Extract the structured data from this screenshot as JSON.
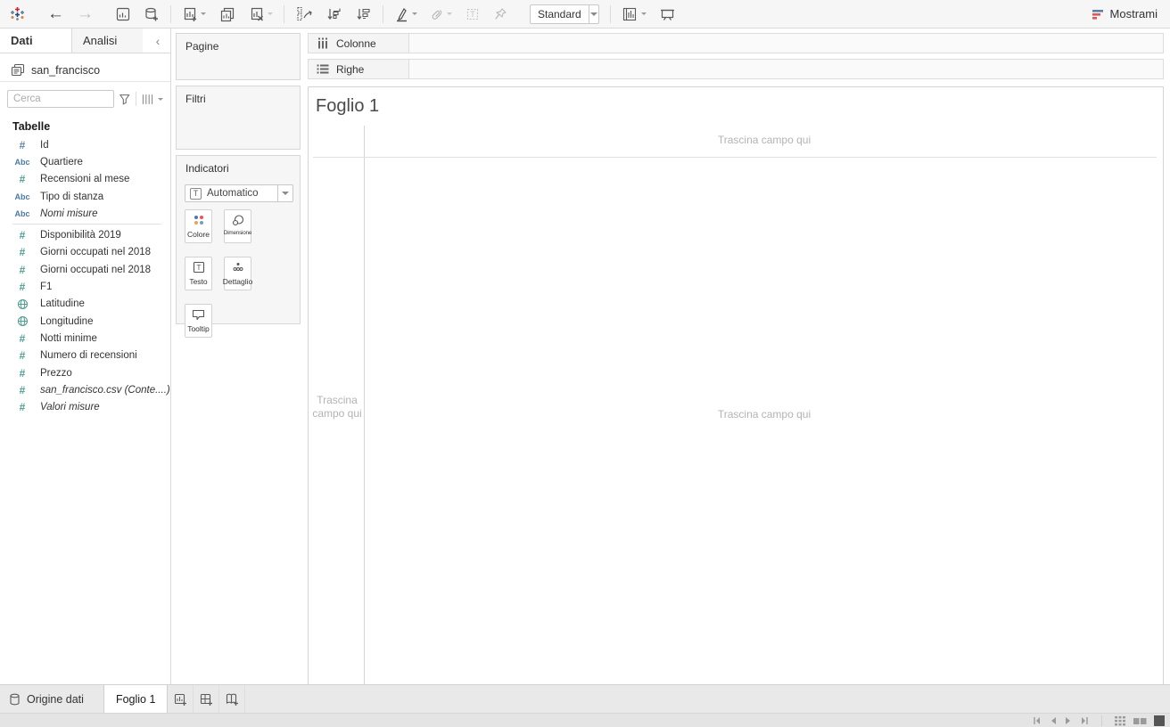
{
  "toolbar": {
    "standard_select_value": "Standard",
    "showme_label": "Mostrami"
  },
  "left_panel": {
    "tabs": {
      "data": "Dati",
      "analytics": "Analisi"
    },
    "datasource_name": "san_francisco",
    "search_placeholder": "Cerca",
    "tables_header": "Tabelle",
    "fields": [
      {
        "name": "Id",
        "type": "number-dimension"
      },
      {
        "name": "Quartiere",
        "type": "string"
      },
      {
        "name": "Recensioni al mese",
        "type": "number"
      },
      {
        "name": "Tipo di stanza",
        "type": "string"
      },
      {
        "name": "Nomi misure",
        "type": "string",
        "italic": true
      },
      {
        "name": "Disponibilità 2019",
        "type": "number"
      },
      {
        "name": "Giorni occupati nel 2018",
        "type": "number"
      },
      {
        "name": "Giorni occupati nel 2018",
        "type": "number"
      },
      {
        "name": "F1",
        "type": "number"
      },
      {
        "name": "Latitudine",
        "type": "geo"
      },
      {
        "name": "Longitudine",
        "type": "geo"
      },
      {
        "name": "Notti minime",
        "type": "number"
      },
      {
        "name": "Numero di recensioni",
        "type": "number"
      },
      {
        "name": "Prezzo",
        "type": "number"
      },
      {
        "name": "san_francisco.csv (Conte....)",
        "type": "number",
        "italic": true
      },
      {
        "name": "Valori misure",
        "type": "number",
        "italic": true
      }
    ]
  },
  "cards": {
    "pages_title": "Pagine",
    "filters_title": "Filtri",
    "marks_title": "Indicatori",
    "mark_type_value": "Automatico",
    "mark_buttons": {
      "color": "Colore",
      "size": "Dimensione",
      "text": "Testo",
      "detail": "Dettaglio",
      "tooltip": "Tooltip"
    }
  },
  "shelves": {
    "columns_label": "Colonne",
    "rows_label": "Righe"
  },
  "sheet": {
    "title": "Foglio 1",
    "drop_hint": "Trascina campo qui"
  },
  "bottom": {
    "datasource_tab": "Origine dati",
    "sheet_tab": "Foglio 1"
  },
  "colors": {
    "measure_green": "#4f9e91",
    "dimension_blue": "#4a79a7",
    "showme_blue": "#5b7fa6",
    "showme_red": "#e05759",
    "color_dots": [
      "#4e79a7",
      "#e15759",
      "#e8a15c",
      "#7b9ab8"
    ]
  }
}
